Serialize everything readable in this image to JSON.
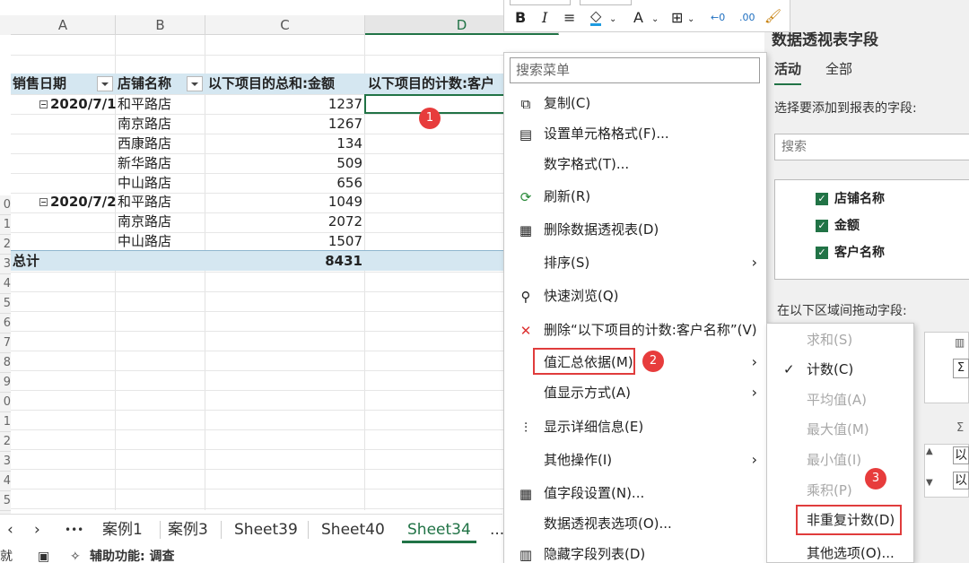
{
  "columns": [
    "A",
    "B",
    "C",
    "D"
  ],
  "row_numbers": [
    "0",
    "1",
    "2",
    "3",
    "4",
    "5",
    "6",
    "7",
    "8",
    "9",
    "0",
    "1",
    "2",
    "3",
    "4",
    "5",
    "6"
  ],
  "pivot": {
    "headers": [
      "销售日期",
      "店铺名称",
      "以下项目的总和:金额",
      "以下项目的计数:客户"
    ],
    "groups": [
      {
        "date": "2020/7/1",
        "rows": [
          {
            "store": "和平路店",
            "amount": "1237"
          },
          {
            "store": "南京路店",
            "amount": "1267"
          },
          {
            "store": "西康路店",
            "amount": "134"
          },
          {
            "store": "新华路店",
            "amount": "509"
          },
          {
            "store": "中山路店",
            "amount": "656"
          }
        ]
      },
      {
        "date": "2020/7/2",
        "rows": [
          {
            "store": "和平路店",
            "amount": "1049"
          },
          {
            "store": "南京路店",
            "amount": "2072"
          },
          {
            "store": "中山路店",
            "amount": "1507"
          }
        ]
      }
    ],
    "total_label": "总计",
    "total_value": "8431",
    "collapse_symbol": "⊟"
  },
  "sheet_tabs": {
    "prev": "‹",
    "next": "›",
    "more": "•••",
    "tabs": [
      "案例1",
      "案例3",
      "Sheet39",
      "Sheet40",
      "Sheet34"
    ],
    "active": "Sheet34",
    "more2": "..."
  },
  "status_bar": {
    "ready": "就绪",
    "accessibility": "辅助功能: 调查"
  },
  "mini_toolbar": {
    "bold": "B",
    "italic": "I",
    "align": "≡",
    "fill": "◇",
    "font_color": "A",
    "borders": "⊞",
    "dec_left": "←0",
    "dec_right": ".00",
    "brush": "🖌"
  },
  "context_menu": {
    "search_placeholder": "搜索菜单",
    "items": [
      {
        "label": "复制(C)",
        "icon": "⧉"
      },
      {
        "label": "设置单元格格式(F)...",
        "icon": "▤"
      },
      {
        "label": "数字格式(T)...",
        "icon": ""
      },
      {
        "label": "刷新(R)",
        "icon": "⟳"
      },
      {
        "label": "删除数据透视表(D)",
        "icon": "▦"
      },
      {
        "label": "排序(S)",
        "icon": ""
      },
      {
        "label": "快速浏览(Q)",
        "icon": "⚲"
      },
      {
        "label": "删除“以下项目的计数:客户名称”(V)",
        "icon": "✕"
      },
      {
        "label": "值汇总依据(M)",
        "icon": ""
      },
      {
        "label": "值显示方式(A)",
        "icon": ""
      },
      {
        "label": "显示详细信息(E)",
        "icon": "⫶"
      },
      {
        "label": "其他操作(I)",
        "icon": ""
      },
      {
        "label": "值字段设置(N)...",
        "icon": "▦"
      },
      {
        "label": "数据透视表选项(O)...",
        "icon": ""
      },
      {
        "label": "隐藏字段列表(D)",
        "icon": "▥"
      }
    ],
    "arrow": "›"
  },
  "submenu": {
    "items": [
      {
        "label": "求和(S)",
        "disabled": true
      },
      {
        "label": "计数(C)",
        "disabled": false,
        "checked": true
      },
      {
        "label": "平均值(A)",
        "disabled": true
      },
      {
        "label": "最大值(M)",
        "disabled": true
      },
      {
        "label": "最小值(I)",
        "disabled": true
      },
      {
        "label": "乘积(P)",
        "disabled": true
      },
      {
        "label": "非重复计数(D)",
        "disabled": false
      },
      {
        "label": "其他选项(O)...",
        "disabled": false
      }
    ],
    "check": "✓"
  },
  "badges": [
    "1",
    "2",
    "3"
  ],
  "field_panel": {
    "title": "数据透视表字段",
    "tabs": [
      "活动",
      "全部"
    ],
    "prompt": "选择要添加到报表的字段:",
    "search_placeholder": "搜索",
    "fields": [
      "店铺名称",
      "金额",
      "客户名称"
    ],
    "drag_prompt": "在以下区域间拖动字段:",
    "sigma": "Σ",
    "partial": "以"
  },
  "colors": {
    "accent": "#217346",
    "pivot_header": "#d5e7f1",
    "highlight": "#e03c3c"
  }
}
